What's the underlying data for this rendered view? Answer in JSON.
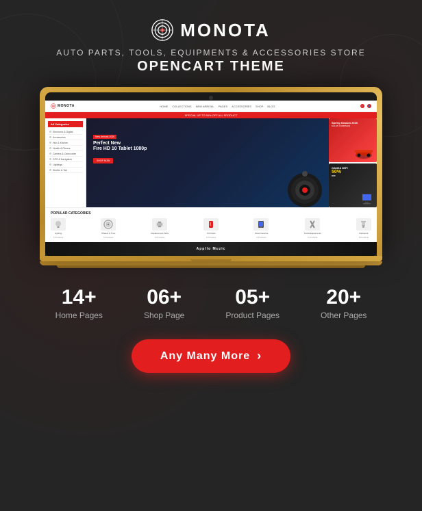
{
  "brand": {
    "logo_text": "MONOTA",
    "tagline": "AUTO PARTS, TOOLS, EQUIPMENTS & ACCESSORIES STORE",
    "theme_subtitle": "OPENCART THEME"
  },
  "laptop_site": {
    "top_banner": "SPECIAL UP TO 50% OFF ALL PRODUCT",
    "hero_tag": "New Arrivals 2020",
    "hero_title_line1": "Perfect New",
    "hero_title_line2": "Fire HD 10 Tablet 1080p",
    "hero_btn": "SHOP NOW",
    "banner1_title": "Spring Season 2020",
    "banner1_sub": "SALES CAMPAIGN",
    "banner2_title": "GANZA WIFI",
    "categories_title": "POPULAR CATEGORIES",
    "categories": [
      {
        "name": "Lighting",
        "sub": "5 Products"
      },
      {
        "name": "Wheels & Tires",
        "sub": "5 Products"
      },
      {
        "name": "Replacement Parts",
        "sub": "5 Products"
      },
      {
        "name": "Oil Fluids",
        "sub": "5 Products"
      },
      {
        "name": "Smart Devices",
        "sub": "5 Products"
      },
      {
        "name": "Tool & Equipments",
        "sub": "5 Products"
      },
      {
        "name": "Paintwork",
        "sub": "5 Products"
      }
    ],
    "sidebar_title": "All Categories",
    "sidebar_items": [
      "Electronic & Digital",
      "Accessories",
      "Hubs & Kitchen",
      "Health & Fitness",
      "Camera & Camcorder",
      "GPS & Navigation",
      "Lightings",
      "Shelter & Tab"
    ],
    "bottom_banner_text": "Appllo Muzic",
    "nav_items": [
      "HOME",
      "COLLECTIONS",
      "NEW ARRIVAL",
      "PAGES",
      "ACCESSORIES",
      "SHOP",
      "BLOG"
    ]
  },
  "stats": [
    {
      "number": "14+",
      "label": "Home Pages"
    },
    {
      "number": "06+",
      "label": "Shop Page"
    },
    {
      "number": "05+",
      "label": "Product Pages"
    },
    {
      "number": "20+",
      "label": "Other Pages"
    }
  ],
  "cta": {
    "label": "Any Many More",
    "arrow": "›"
  }
}
